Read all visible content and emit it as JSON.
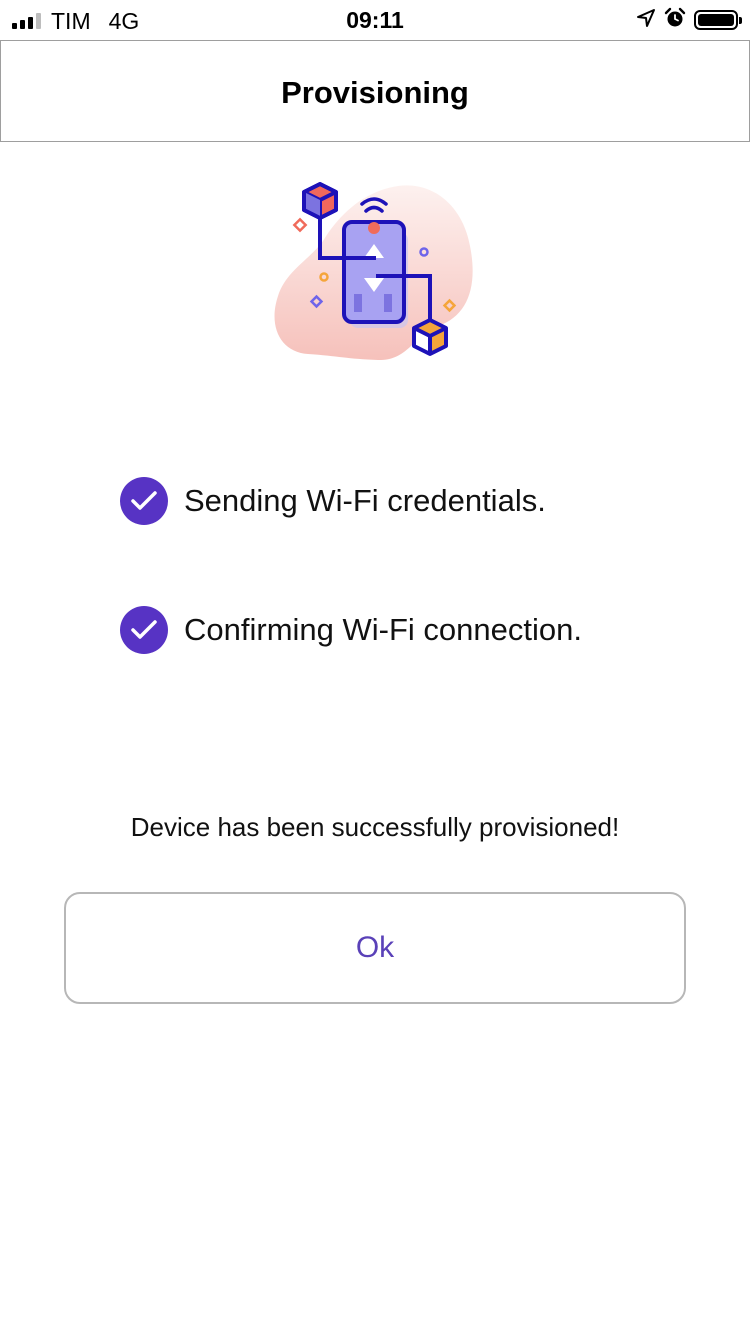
{
  "status_bar": {
    "carrier": "TIM",
    "network": "4G",
    "time": "09:11",
    "icons": [
      "signal-icon",
      "location-arrow-icon",
      "alarm-icon",
      "battery-icon"
    ]
  },
  "nav": {
    "title": "Provisioning"
  },
  "illustration": {
    "icon": "provisioning-illustration"
  },
  "steps": [
    {
      "label": "Sending Wi-Fi credentials.",
      "status": "done",
      "icon": "check-circle-icon"
    },
    {
      "label": "Confirming Wi-Fi connection.",
      "status": "done",
      "icon": "check-circle-icon"
    }
  ],
  "message": "Device has been successfully provisioned!",
  "ok_button": {
    "label": "Ok"
  },
  "colors": {
    "accent": "#5733c4",
    "button_text": "#5a41b8",
    "border": "#b7b7b7"
  }
}
